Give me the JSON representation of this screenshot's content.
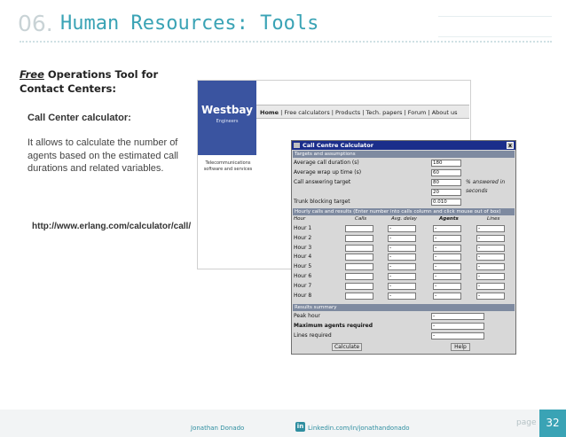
{
  "header": {
    "number": "06.",
    "title": "Human Resources:  Tools"
  },
  "intro": {
    "free": "Free",
    "rest": " Operations Tool for",
    "line2": "Contact Centers:"
  },
  "calc_card": {
    "heading": "Call Center calculator:",
    "desc": "It allows to calculate the number of agents based on the estimated call durations and related variables.",
    "url": "http://www.erlang.com/calculator/call/"
  },
  "website": {
    "logo": "Westbay",
    "logo_sub": "Engineers",
    "tagline": "Telecommunications software and services",
    "nav": [
      "Home",
      "Free calculators",
      "Products",
      "Tech. papers",
      "Forum",
      "About us"
    ]
  },
  "calculator": {
    "title": "Call Centre Calculator",
    "close": "x",
    "sec_targets": "Targets and assumptions",
    "targets": [
      {
        "label": "Average call duration (s)",
        "value": "180"
      },
      {
        "label": "Average wrap up time (s)",
        "value": "60"
      },
      {
        "label": "Call answering target",
        "value": "80",
        "note": "% answered in"
      },
      {
        "label": "",
        "value": "20",
        "note": "seconds"
      },
      {
        "label": "Trunk blocking target",
        "value": "0.010"
      }
    ],
    "sec_hourly": "Hourly calls and results (Enter number into calls column and click mouse out of box)",
    "cols": [
      "Hour",
      "Calls",
      "Avg. delay",
      "Agents",
      "Lines"
    ],
    "hours": [
      "Hour 1",
      "Hour 2",
      "Hour 3",
      "Hour 4",
      "Hour 5",
      "Hour 6",
      "Hour 7",
      "Hour 8"
    ],
    "dash": "-",
    "sec_results": "Results summary",
    "results": [
      "Peak hour",
      "Maximum agents required",
      "Lines required"
    ],
    "btn_calc": "Calculate",
    "btn_help": "Help"
  },
  "footer": {
    "name": "Jonathan  Donado",
    "li": "in",
    "url": "Linkedin.com/in/jonathandonado",
    "page_label": "page",
    "page": "32"
  },
  "colors": {
    "accent": "#3aa3b5",
    "dialog_title": "#1b2e8b",
    "section": "#7e8aa0",
    "logo": "#3a54a0"
  }
}
